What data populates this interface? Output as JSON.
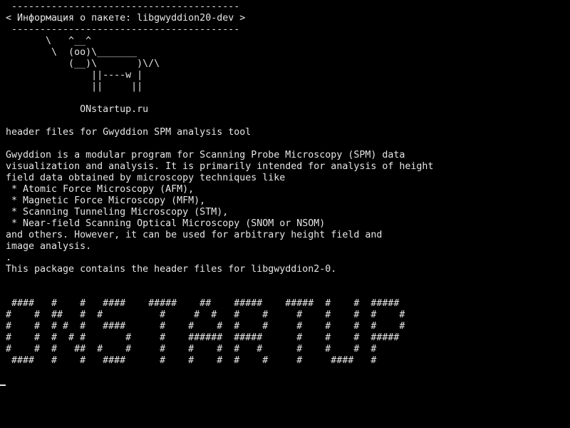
{
  "terminal": {
    "colors": {
      "background": "#000000",
      "foreground": "#e6e6e6"
    },
    "lines": [
      " ----------------------------------------",
      "< Информация о пакете: libgwyddion20-dev >",
      " ----------------------------------------",
      "       \\   ^__^",
      "        \\  (oo)\\_______",
      "           (__)\\       )\\/\\",
      "               ||----w |",
      "               ||     ||",
      "",
      "             ONstartup.ru",
      "",
      "header files for Gwyddion SPM analysis tool",
      "",
      "Gwyddion is a modular program for Scanning Probe Microscopy (SPM) data",
      "visualization and analysis. It is primarily intended for analysis of height",
      "field data obtained by microscopy techniques like",
      " * Atomic Force Microscopy (AFM),",
      " * Magnetic Force Microscopy (MFM),",
      " * Scanning Tunneling Microscopy (STM),",
      " * Near-field Scanning Optical Microscopy (SNOM or NSOM)",
      "and others. However, it can be used for arbitrary height field and",
      "image analysis.",
      ".",
      "This package contains the header files for libgwyddion2-0.",
      "",
      "",
      " ####   #    #   ####    #####    ##    #####    #####  #    #  #####",
      "#    #  ##   #  #          #     #  #   #    #     #    #    #  #    #",
      "#    #  # #  #   ####      #    #    #  #    #     #    #    #  #    #",
      "#    #  #  # #       #     #    ######  #####      #    #    #  #####",
      "#    #  #   ##  #    #     #    #    #  #   #      #    #    #  #",
      " ####   #    #   ####      #    #    #  #    #     #     ####   #"
    ]
  }
}
